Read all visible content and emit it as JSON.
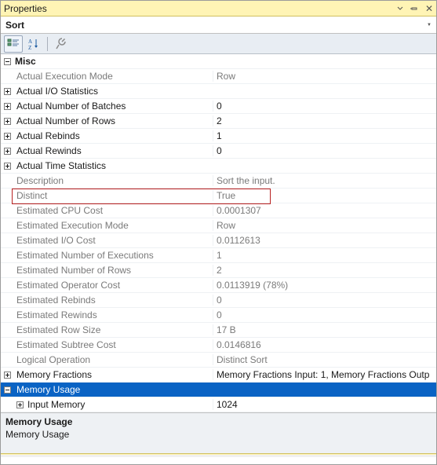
{
  "window": {
    "title": "Properties"
  },
  "object_selector": {
    "text": "Sort"
  },
  "category": {
    "name": "Misc",
    "expanded": true
  },
  "rows": [
    {
      "expand": "",
      "label": "Actual Execution Mode",
      "value": "Row",
      "dim": true
    },
    {
      "expand": "+",
      "label": "Actual I/O Statistics",
      "value": "",
      "dim": false
    },
    {
      "expand": "+",
      "label": "Actual Number of Batches",
      "value": "0",
      "dim": false
    },
    {
      "expand": "+",
      "label": "Actual Number of Rows",
      "value": "2",
      "dim": false
    },
    {
      "expand": "+",
      "label": "Actual Rebinds",
      "value": "1",
      "dim": false
    },
    {
      "expand": "+",
      "label": "Actual Rewinds",
      "value": "0",
      "dim": false
    },
    {
      "expand": "+",
      "label": "Actual Time Statistics",
      "value": "",
      "dim": false
    },
    {
      "expand": "",
      "label": "Description",
      "value": "Sort the input.",
      "dim": true
    },
    {
      "expand": "",
      "label": "Distinct",
      "value": "True",
      "dim": true
    },
    {
      "expand": "",
      "label": "Estimated CPU Cost",
      "value": "0.0001307",
      "dim": true
    },
    {
      "expand": "",
      "label": "Estimated Execution Mode",
      "value": "Row",
      "dim": true
    },
    {
      "expand": "",
      "label": "Estimated I/O Cost",
      "value": "0.0112613",
      "dim": true
    },
    {
      "expand": "",
      "label": "Estimated Number of Executions",
      "value": "1",
      "dim": true
    },
    {
      "expand": "",
      "label": "Estimated Number of Rows",
      "value": "2",
      "dim": true
    },
    {
      "expand": "",
      "label": "Estimated Operator Cost",
      "value": "0.0113919 (78%)",
      "dim": true
    },
    {
      "expand": "",
      "label": "Estimated Rebinds",
      "value": "0",
      "dim": true
    },
    {
      "expand": "",
      "label": "Estimated Rewinds",
      "value": "0",
      "dim": true
    },
    {
      "expand": "",
      "label": "Estimated Row Size",
      "value": "17 B",
      "dim": true
    },
    {
      "expand": "",
      "label": "Estimated Subtree Cost",
      "value": "0.0146816",
      "dim": true
    },
    {
      "expand": "",
      "label": "Logical Operation",
      "value": "Distinct Sort",
      "dim": true
    },
    {
      "expand": "+",
      "label": "Memory Fractions",
      "value": "Memory Fractions Input: 1, Memory Fractions Outp",
      "dim": false
    },
    {
      "expand": "-",
      "label": "Memory Usage",
      "value": "",
      "dim": false,
      "selected": true
    },
    {
      "expand": "+",
      "label": "Input Memory",
      "value": "1024",
      "dim": false,
      "indent": 2
    }
  ],
  "description_pane": {
    "name": "Memory Usage",
    "help": "Memory Usage"
  }
}
